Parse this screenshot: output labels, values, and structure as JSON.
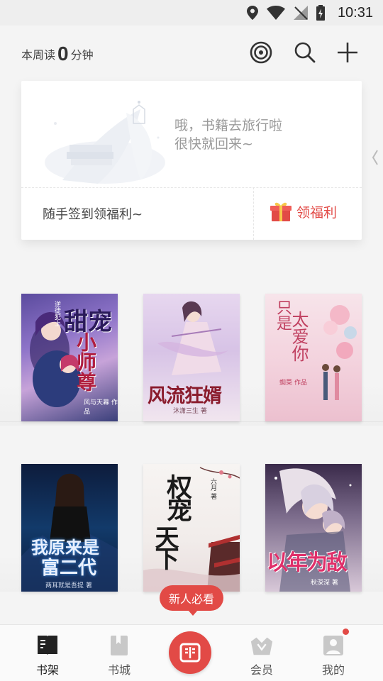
{
  "status_bar": {
    "time": "10:31"
  },
  "header": {
    "week_read_prefix": "本周读",
    "week_read_minutes": "0",
    "week_read_suffix": "分钟"
  },
  "sign_card": {
    "message_line1": "哦，书籍去旅行啦",
    "message_line2": "很快就回来~",
    "sign_text": "随手签到领福利~",
    "welfare_label": "领福利"
  },
  "books": [
    {
      "title": "甜宠小师尊",
      "title_a": "甜宠",
      "title_b": "小师尊",
      "tag": "逆徒犯上",
      "author": "风与天幕 作品"
    },
    {
      "title": "风流狂婿",
      "author": "沐潇三生 著"
    },
    {
      "title": "只是太爱你",
      "title_a": "只是",
      "title_b": "太爱你",
      "author": "蜘菜 作品"
    },
    {
      "title": "我原来是富二代",
      "title_a": "我原来是",
      "title_b": "富二代",
      "author": "两耳就是吾提 著"
    },
    {
      "title": "权宠天下",
      "title_a": "权宠",
      "title_b": "天下",
      "author": "六月 著"
    },
    {
      "title": "以年为敌",
      "author": "秋深深 著"
    }
  ],
  "new_user_badge": "新人必看",
  "bottom_nav": {
    "items": [
      {
        "label": "书架",
        "icon": "bookshelf-icon"
      },
      {
        "label": "书城",
        "icon": "bookstore-icon"
      },
      {
        "label": "会员",
        "icon": "crown-icon"
      },
      {
        "label": "我的",
        "icon": "profile-icon"
      }
    ]
  },
  "colors": {
    "accent": "#e24a46",
    "background": "#f4f4f4"
  }
}
